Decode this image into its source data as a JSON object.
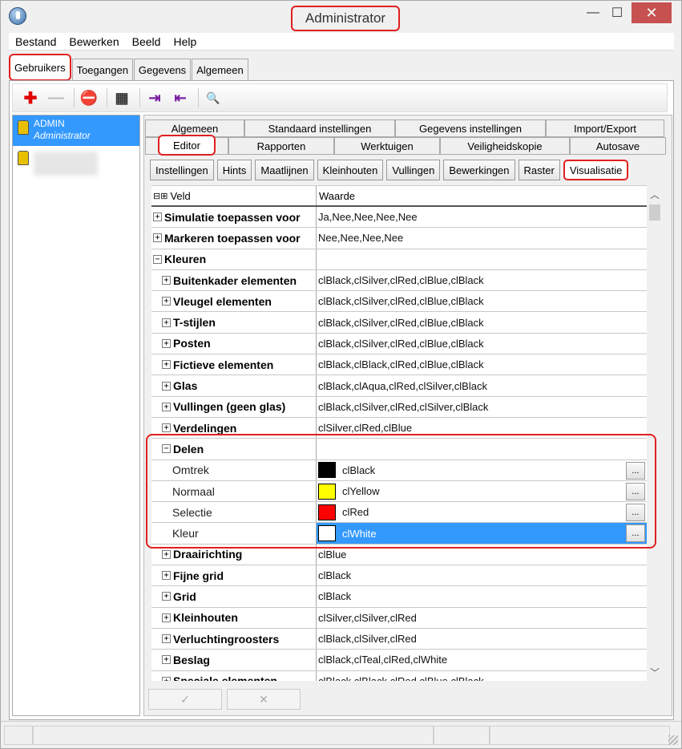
{
  "window": {
    "title": "Administrator",
    "min_symbol": "—",
    "max_symbol": "☐",
    "close_symbol": "✕"
  },
  "menu": [
    "Bestand",
    "Bewerken",
    "Beeld",
    "Help"
  ],
  "top_tabs": [
    "Gebruikers",
    "Toegangen",
    "Gegevens",
    "Algemeen"
  ],
  "toolbar": {
    "add": "✚",
    "remove": "—",
    "delete": "⛔",
    "properties": "▦",
    "import": "⇥",
    "export": "⇤",
    "search": "🔍"
  },
  "users": [
    {
      "name": "ADMIN",
      "role": "Administrator"
    }
  ],
  "editor_tabs_row1": [
    "Algemeen",
    "Standaard instellingen",
    "Gegevens instellingen",
    "Import/Export"
  ],
  "editor_tabs_row2": [
    "Editor",
    "Rapporten",
    "Werktuigen",
    "Veiligheidskopie",
    "Autosave"
  ],
  "subtabs": [
    "Instellingen",
    "Hints",
    "Maatlijnen",
    "Kleinhouten",
    "Vullingen",
    "Bewerkingen",
    "Raster",
    "Visualisatie"
  ],
  "grid": {
    "header_veld": "Veld",
    "header_waarde": "Waarde",
    "header_icons": "⊟⊞",
    "rows": [
      {
        "label": "Simulatie toepassen voor",
        "value": "Ja,Nee,Nee,Nee,Nee",
        "indent": 0,
        "toggle": "+"
      },
      {
        "label": "Markeren toepassen voor",
        "value": "Nee,Nee,Nee,Nee",
        "indent": 0,
        "toggle": "+"
      },
      {
        "label": "Kleuren",
        "value": "",
        "indent": 0,
        "toggle": "−"
      },
      {
        "label": "Buitenkader elementen",
        "value": "clBlack,clSilver,clRed,clBlue,clBlack",
        "indent": 1,
        "toggle": "+"
      },
      {
        "label": "Vleugel elementen",
        "value": "clBlack,clSilver,clRed,clBlue,clBlack",
        "indent": 1,
        "toggle": "+"
      },
      {
        "label": "T-stijlen",
        "value": "clBlack,clSilver,clRed,clBlue,clBlack",
        "indent": 1,
        "toggle": "+"
      },
      {
        "label": "Posten",
        "value": "clBlack,clSilver,clRed,clBlue,clBlack",
        "indent": 1,
        "toggle": "+"
      },
      {
        "label": "Fictieve elementen",
        "value": "clBlack,clBlack,clRed,clBlue,clBlack",
        "indent": 1,
        "toggle": "+"
      },
      {
        "label": "Glas",
        "value": "clBlack,clAqua,clRed,clSilver,clBlack",
        "indent": 1,
        "toggle": "+"
      },
      {
        "label": "Vullingen (geen glas)",
        "value": "clBlack,clSilver,clRed,clSilver,clBlack",
        "indent": 1,
        "toggle": "+"
      },
      {
        "label": "Verdelingen",
        "value": "clSilver,clRed,clBlue",
        "indent": 1,
        "toggle": "+"
      },
      {
        "label": "Delen",
        "value": "",
        "indent": 1,
        "toggle": "−"
      },
      {
        "label": "Omtrek",
        "value": "clBlack",
        "indent": 2,
        "swatch": "#000000"
      },
      {
        "label": "Normaal",
        "value": "clYellow",
        "indent": 2,
        "swatch": "#ffff00"
      },
      {
        "label": "Selectie",
        "value": "clRed",
        "indent": 2,
        "swatch": "#ff0000"
      },
      {
        "label": "Kleur",
        "value": "clWhite",
        "indent": 2,
        "swatch": "#ffffff",
        "selected": true
      },
      {
        "label": "Draairichting",
        "value": "clBlue",
        "indent": 1,
        "toggle": "+"
      },
      {
        "label": "Fijne grid",
        "value": "clBlack",
        "indent": 1,
        "toggle": "+"
      },
      {
        "label": "Grid",
        "value": "clBlack",
        "indent": 1,
        "toggle": "+"
      },
      {
        "label": "Kleinhouten",
        "value": "clSilver,clSilver,clRed",
        "indent": 1,
        "toggle": "+"
      },
      {
        "label": "Verluchtingroosters",
        "value": "clBlack,clSilver,clRed",
        "indent": 1,
        "toggle": "+"
      },
      {
        "label": "Beslag",
        "value": "clBlack,clTeal,clRed,clWhite",
        "indent": 1,
        "toggle": "+"
      },
      {
        "label": "Speciale elementen",
        "value": "clBlack,clBlack,clRed,clBlue,clBlack",
        "indent": 1,
        "toggle": "+"
      }
    ],
    "ellipsis": "..."
  },
  "bottom_buttons": {
    "ok": "✓",
    "cancel": "✕"
  },
  "colors": {
    "selection": "#3399ff",
    "highlight_border": "#e02020"
  }
}
